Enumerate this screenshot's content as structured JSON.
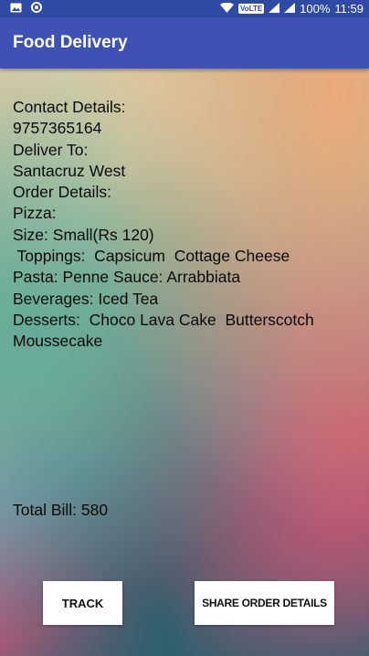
{
  "status_bar": {
    "left_icons": [
      "image-icon",
      "circle-notification-icon"
    ],
    "volte": "VoLTE",
    "battery": "100%",
    "time": "11:59"
  },
  "app_bar": {
    "title": "Food Delivery",
    "color": "#3f51b5"
  },
  "order": {
    "contact_label": "Contact Details:",
    "contact_number": "9757365164",
    "deliver_label": "Deliver To:",
    "deliver_address": "Santacruz West",
    "details_label": "Order Details:",
    "pizza_label": "Pizza:",
    "pizza_size": "Size: Small(Rs 120)",
    "pizza_toppings": " Toppings:  Capsicum  Cottage Cheese",
    "pasta": "Pasta: Penne Sauce: Arrabbiata",
    "beverages": "Beverages: Iced Tea",
    "desserts": "Desserts:  Choco Lava Cake  Butterscotch Moussecake"
  },
  "total_bill": "Total Bill: 580",
  "buttons": {
    "track": "TRACK",
    "share": "SHARE ORDER DETAILS"
  }
}
